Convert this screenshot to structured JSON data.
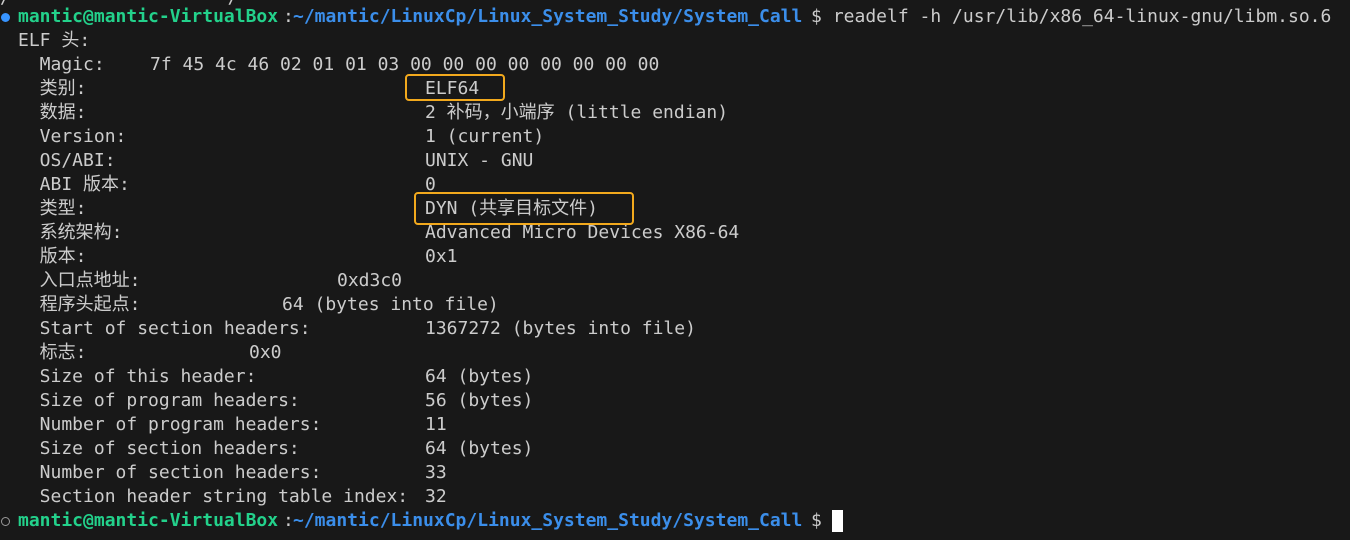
{
  "terminal": {
    "top_partial_line": "/                    /",
    "prompt_user_host": "mantic@mantic-VirtualBox",
    "prompt_path": "~/mantic/LinuxCp/Linux_System_Study/System_Call",
    "prompt_symbol": "$",
    "command": " readelf -h /usr/lib/x86_64-linux-gnu/libm.so.6",
    "elf_header_title": "ELF 头:",
    "fields": {
      "magic_label": "  Magic:",
      "magic_value": "7f 45 4c 46 02 01 01 03 00 00 00 00 00 00 00 00",
      "class_label": "  类别:",
      "class_value": "ELF64",
      "data_label": "  数据:",
      "data_value": "2 补码，小端序 (little endian)",
      "version_label": "  Version:",
      "version_value": "1 (current)",
      "osabi_label": "  OS/ABI:",
      "osabi_value": "UNIX - GNU",
      "abi_version_label": "  ABI 版本:",
      "abi_version_value": "0",
      "type_label": "  类型:",
      "type_value": "DYN (共享目标文件)",
      "machine_label": "  系统架构:",
      "machine_value": "Advanced Micro Devices X86-64",
      "file_version_label": "  版本:",
      "file_version_value": "0x1",
      "entry_label": "  入口点地址:",
      "entry_value": "0xd3c0",
      "phoff_label": "  程序头起点:",
      "phoff_value": "64 (bytes into file)",
      "shoff_label": "  Start of section headers:",
      "shoff_value": "1367272 (bytes into file)",
      "flags_label": "  标志:",
      "flags_value": "0x0",
      "ehsize_label": "  Size of this header:",
      "ehsize_value": "64 (bytes)",
      "phentsize_label": "  Size of program headers:",
      "phentsize_value": "56 (bytes)",
      "phnum_label": "  Number of program headers:",
      "phnum_value": "11",
      "shentsize_label": "  Size of section headers:",
      "shentsize_value": "64 (bytes)",
      "shnum_label": "  Number of section headers:",
      "shnum_value": "33",
      "shstrndx_label": "  Section header string table index:",
      "shstrndx_value": "32"
    }
  },
  "colors": {
    "background": "#181818",
    "foreground": "#cccccc",
    "prompt_user": "#23d18b",
    "prompt_path": "#3b8eea",
    "highlight_box": "#f2a91d",
    "command_marker": "#3794ff"
  }
}
